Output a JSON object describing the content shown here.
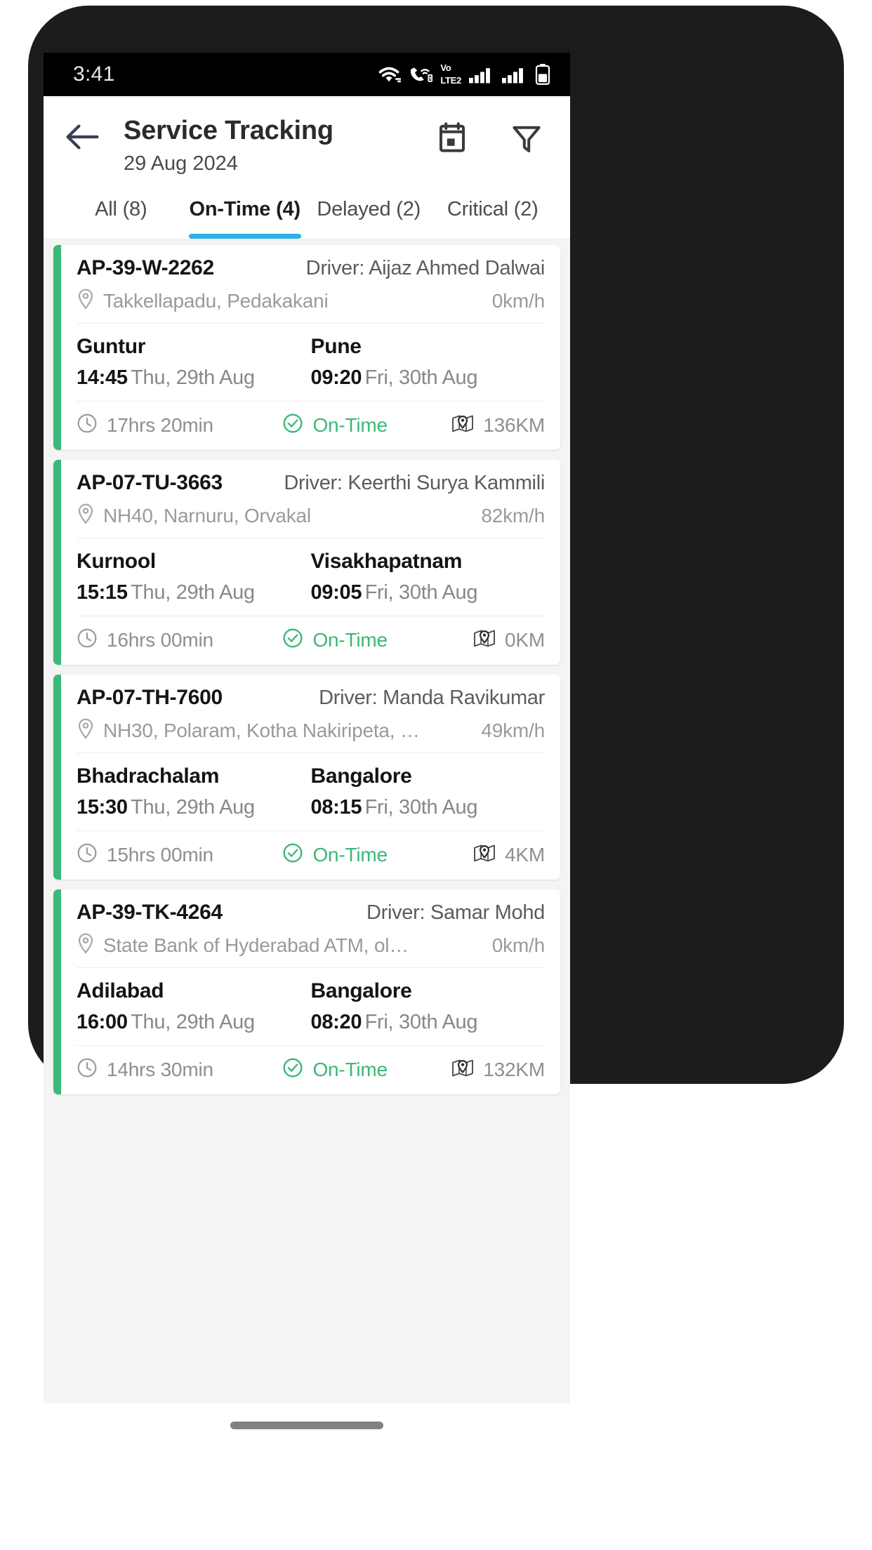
{
  "status_bar": {
    "clock": "3:41",
    "volte_top": "Vo",
    "volte_bottom": "LTE",
    "volte_sim": "2",
    "icons": [
      "wifi-icon",
      "vowifi-call-icon",
      "volte-icon",
      "signal-bars-sim1-icon",
      "signal-bars-sim2-icon",
      "battery-icon"
    ]
  },
  "app_bar": {
    "back_icon": "back-arrow-icon",
    "title": "Service Tracking",
    "subtitle": "29 Aug 2024",
    "calendar_icon": "calendar-icon",
    "filter_icon": "filter-icon"
  },
  "tabs": [
    {
      "label": "All (8)",
      "active": false
    },
    {
      "label": "On-Time (4)",
      "active": true
    },
    {
      "label": "Delayed (2)",
      "active": false
    },
    {
      "label": "Critical (2)",
      "active": false
    }
  ],
  "colors": {
    "accent_green": "#3cb878",
    "tab_active_underline": "#2eb2e8",
    "status_ontime": "#3cb878",
    "list_background": "#f4f4f4",
    "card_background": "#ffffff"
  },
  "driver_prefix": "Driver: ",
  "trips": [
    {
      "vehicle_no": "AP-39-W-2262",
      "driver": "Driver: Aijaz Ahmed Dalwai",
      "location": "Takkellapadu, Pedakakani",
      "speed": "0km/h",
      "origin_city": "Guntur",
      "origin_time": "14:45",
      "origin_date": "Thu, 29th Aug",
      "dest_city": "Pune",
      "dest_time": "09:20",
      "dest_date": "Fri, 30th Aug",
      "duration": "17hrs 20min",
      "status": "On-Time",
      "distance": "136KM",
      "accent": "#3cb878"
    },
    {
      "vehicle_no": "AP-07-TU-3663",
      "driver": "Driver: Keerthi Surya Kammili",
      "location": "NH40, Narnuru, Orvakal",
      "speed": "82km/h",
      "origin_city": "Kurnool",
      "origin_time": "15:15",
      "origin_date": "Thu, 29th Aug",
      "dest_city": "Visakhapatnam",
      "dest_time": "09:05",
      "dest_date": "Fri, 30th Aug",
      "duration": "16hrs 00min",
      "status": "On-Time",
      "distance": "0KM",
      "accent": "#3cb878"
    },
    {
      "vehicle_no": "AP-07-TH-7600",
      "driver": "Driver: Manda Ravikumar",
      "location": "NH30, Polaram, Kotha Nakiripeta, …",
      "speed": "49km/h",
      "origin_city": "Bhadrachalam",
      "origin_time": "15:30",
      "origin_date": "Thu, 29th Aug",
      "dest_city": "Bangalore",
      "dest_time": "08:15",
      "dest_date": "Fri, 30th Aug",
      "duration": "15hrs 00min",
      "status": "On-Time",
      "distance": "4KM",
      "accent": "#3cb878"
    },
    {
      "vehicle_no": "AP-39-TK-4264",
      "driver": "Driver: Samar Mohd",
      "location": "State Bank of Hyderabad ATM, ol…",
      "speed": "0km/h",
      "origin_city": "Adilabad",
      "origin_time": "16:00",
      "origin_date": "Thu, 29th Aug",
      "dest_city": "Bangalore",
      "dest_time": "08:20",
      "dest_date": "Fri, 30th Aug",
      "duration": "14hrs 30min",
      "status": "On-Time",
      "distance": "132KM",
      "accent": "#3cb878"
    }
  ],
  "icon_names": {
    "location_pin": "location-pin-icon",
    "clock": "clock-icon",
    "check_circle": "check-circle-icon",
    "map": "map-pin-icon"
  }
}
